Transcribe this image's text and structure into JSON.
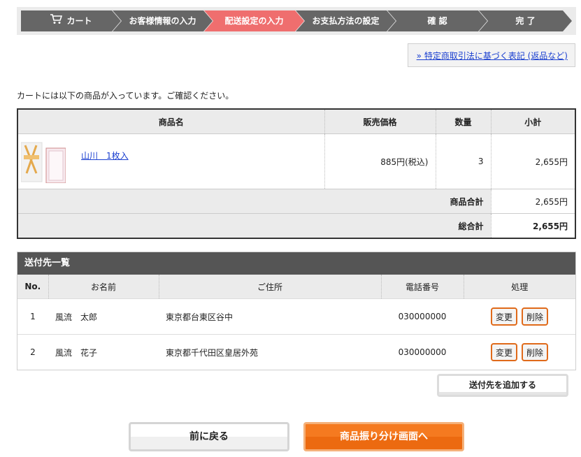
{
  "steps": [
    {
      "label": "カート",
      "icon": "cart-icon"
    },
    {
      "label": "お客様情報の入力"
    },
    {
      "label": "配送設定の入力"
    },
    {
      "label": "お支払方法の設定"
    },
    {
      "label": "確 認"
    },
    {
      "label": "完 了"
    }
  ],
  "colors": {
    "active_step": "#ef6e6e",
    "step": "#666666",
    "accent": "#ec6a10"
  },
  "law_link": "» 特定商取引法に基づく表記 (返品など)",
  "intro": "カートには以下の商品が入っています。ご確認ください。",
  "cart": {
    "headers": {
      "name": "商品名",
      "price": "販売価格",
      "qty": "数量",
      "subtotal": "小計"
    },
    "item": {
      "name": "山川　1枚入",
      "price": "885円(税込)",
      "qty": "3",
      "subtotal": "2,655円"
    },
    "goods_total_label": "商品合計",
    "goods_total": "2,655円",
    "grand_total_label": "総合計",
    "grand_total": "2,655円"
  },
  "shipping": {
    "title": "送付先一覧",
    "headers": {
      "no": "No.",
      "name": "お名前",
      "address": "ご住所",
      "phone": "電話番号",
      "action": "処理"
    },
    "rows": [
      {
        "no": "1",
        "name": "風流　太郎",
        "address": "東京都台東区谷中",
        "phone": "030000000",
        "edit": "変更",
        "delete": "削除"
      },
      {
        "no": "2",
        "name": "風流　花子",
        "address": "東京都千代田区皇居外苑",
        "phone": "030000000",
        "edit": "変更",
        "delete": "削除"
      }
    ],
    "add_label": "送付先を追加する"
  },
  "nav": {
    "back": "前に戻る",
    "next": "商品振り分け画面へ"
  }
}
